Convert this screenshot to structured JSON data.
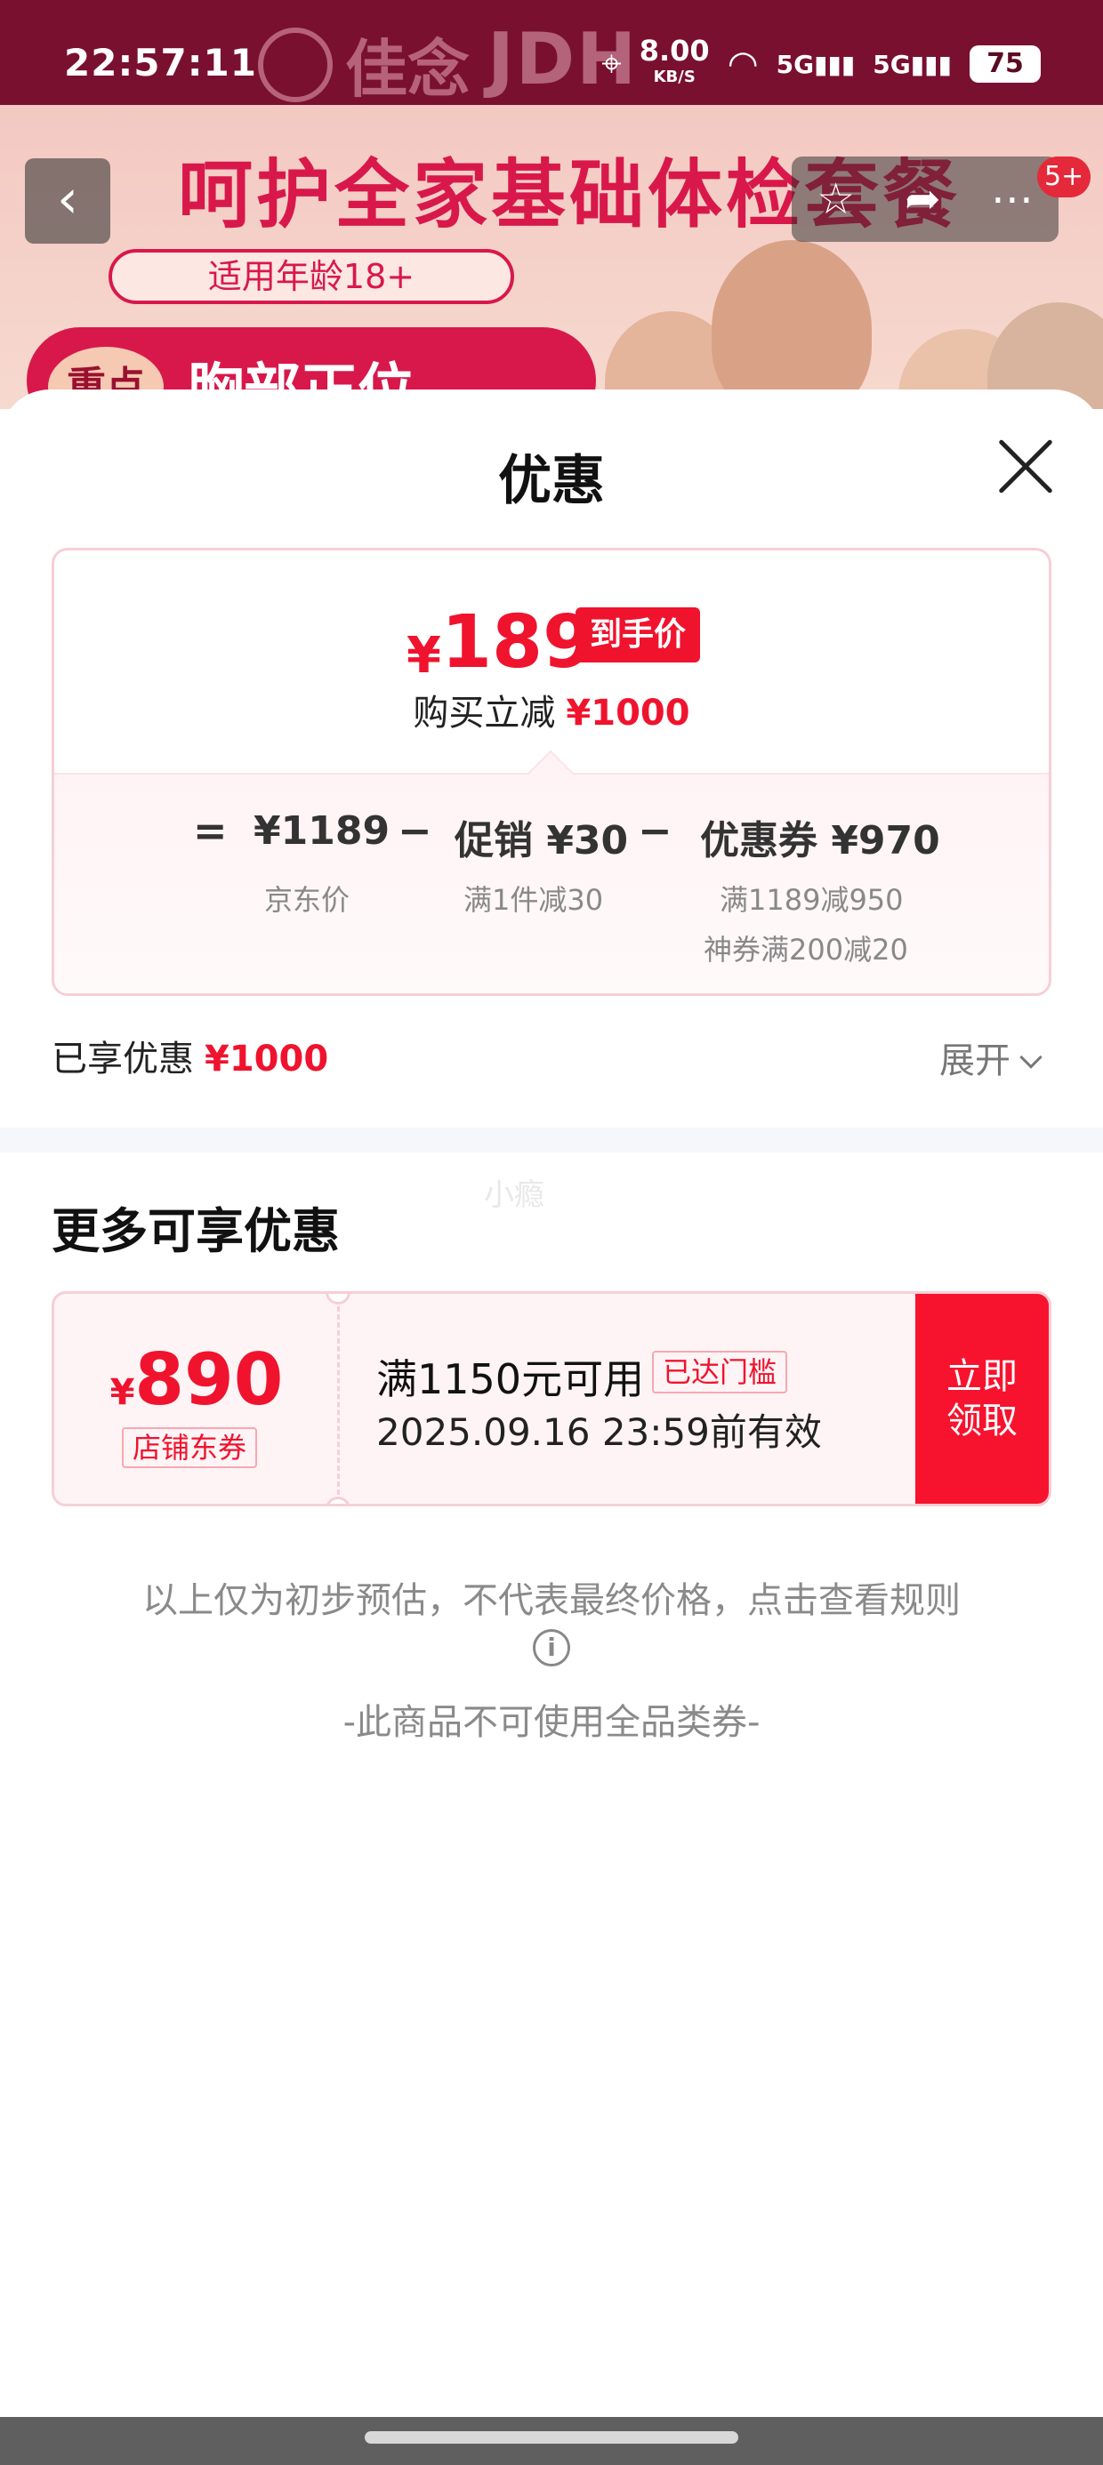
{
  "status_bar": {
    "time": "22:57:11",
    "speed": "8.00",
    "speed_unit": "KB/S",
    "signal_1": "5G",
    "signal_2": "5G",
    "battery": "75"
  },
  "background": {
    "app_logo_text": "佳念",
    "brand_text": "JDH",
    "banner_title": "呵护全家基础体检套餐",
    "banner_age": "适用年龄18+",
    "banner_badge": "重点",
    "banner_item": "胸部正位",
    "nav_badge": "5+"
  },
  "sheet": {
    "title": "优惠",
    "price_card": {
      "currency": "¥",
      "final_price": "189",
      "final_price_tag": "到手价",
      "reduce_label": "购买立减",
      "reduce_amount": "¥1000",
      "equals": "=",
      "jd_price": "¥1189",
      "jd_price_label": "京东价",
      "minus": "−",
      "promo": "促销 ¥30",
      "promo_detail": "满1件减30",
      "coupon": "优惠券 ¥970",
      "coupon_detail_1": "满1189减950",
      "coupon_detail_2": "神券满200减20"
    },
    "enjoyed_label": "已享优惠",
    "enjoyed_amount": "¥1000",
    "expand_label": "展开",
    "watermark": "小瘾",
    "more_title": "更多可享优惠",
    "coupon_item": {
      "currency": "¥",
      "amount": "890",
      "type": "店铺东券",
      "condition": "满1150元可用",
      "badge": "已达门槛",
      "validity": "2025.09.16 23:59前有效",
      "claim_line1": "立即",
      "claim_line2": "领取"
    },
    "note": "以上仅为初步预估，不代表最终价格，点击查看规则",
    "note2": "-此商品不可使用全品类券-"
  },
  "colors": {
    "accent_red": "#f0132e",
    "header_maroon": "#7a1030"
  }
}
